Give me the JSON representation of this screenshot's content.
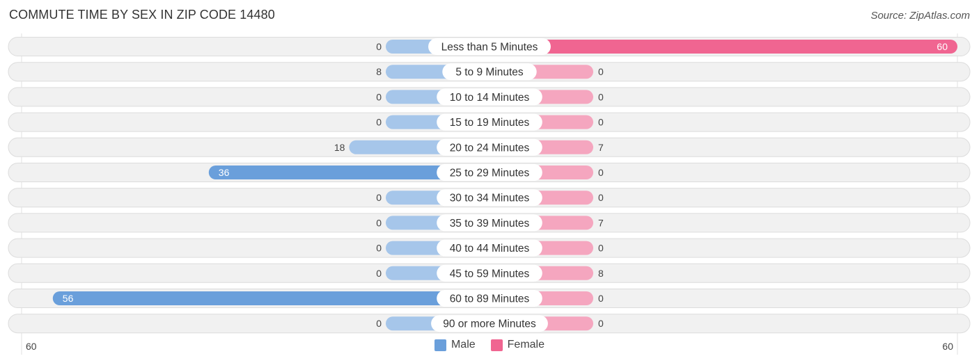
{
  "title": "COMMUTE TIME BY SEX IN ZIP CODE 14480",
  "source": "Source: ZipAtlas.com",
  "colors": {
    "male": "#6a9fdb",
    "male_light": "#a6c6ea",
    "female": "#f06591",
    "female_light": "#f5a6bf",
    "track": "#f1f1f1"
  },
  "legend": [
    {
      "label": "Male",
      "color": "#6a9fdb"
    },
    {
      "label": "Female",
      "color": "#f06591"
    }
  ],
  "chart_data": {
    "type": "bar",
    "orientation": "horizontal-diverging",
    "title": "COMMUTE TIME BY SEX IN ZIP CODE 14480",
    "categories": [
      "Less than 5 Minutes",
      "5 to 9 Minutes",
      "10 to 14 Minutes",
      "15 to 19 Minutes",
      "20 to 24 Minutes",
      "25 to 29 Minutes",
      "30 to 34 Minutes",
      "35 to 39 Minutes",
      "40 to 44 Minutes",
      "45 to 59 Minutes",
      "60 to 89 Minutes",
      "90 or more Minutes"
    ],
    "series": [
      {
        "name": "Male",
        "values": [
          0,
          8,
          0,
          0,
          18,
          36,
          0,
          0,
          0,
          0,
          56,
          0
        ]
      },
      {
        "name": "Female",
        "values": [
          60,
          0,
          0,
          0,
          7,
          0,
          0,
          7,
          0,
          8,
          0,
          0
        ]
      }
    ],
    "axis_left_label": "60",
    "axis_right_label": "60",
    "xlim": [
      -60,
      60
    ],
    "legend_position": "bottom-center"
  }
}
